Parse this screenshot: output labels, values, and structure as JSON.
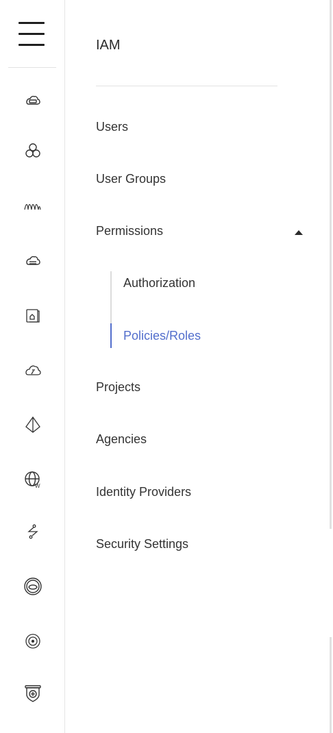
{
  "sidebar": {
    "icons": [
      "cloud-server-icon",
      "cluster-icon",
      "functions-icon",
      "cloud-disk-icon",
      "file-storage-icon",
      "cloud-speed-icon",
      "network-topology-icon",
      "globe-w-icon",
      "link-icon",
      "security-target-icon",
      "monitor-eye-icon",
      "shield-icon"
    ]
  },
  "panel": {
    "title": "IAM",
    "items": [
      {
        "label": "Users"
      },
      {
        "label": "User Groups"
      },
      {
        "label": "Permissions",
        "expanded": true,
        "children": [
          {
            "label": "Authorization",
            "active": false
          },
          {
            "label": "Policies/Roles",
            "active": true
          }
        ]
      },
      {
        "label": "Projects"
      },
      {
        "label": "Agencies"
      },
      {
        "label": "Identity Providers"
      },
      {
        "label": "Security Settings"
      }
    ]
  },
  "colors": {
    "active": "#526ecc",
    "text": "#333333",
    "divider": "#e2e2e2"
  }
}
